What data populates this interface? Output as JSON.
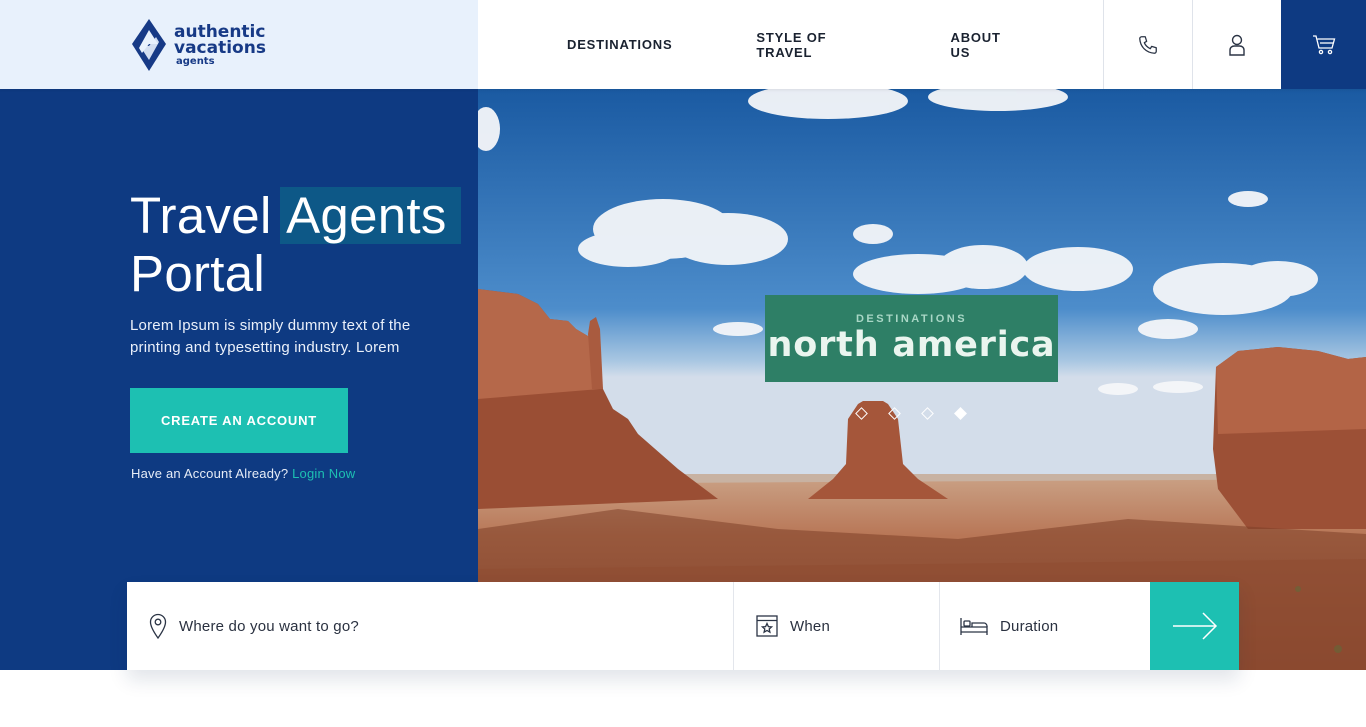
{
  "brand": {
    "line1": "authentic",
    "line2": "vacations",
    "line3": "agents"
  },
  "nav": {
    "items": [
      "DESTINATIONS",
      "STYLE OF TRAVEL",
      "ABOUT US"
    ]
  },
  "header_icons": [
    "phone-icon",
    "user-icon",
    "cart-icon"
  ],
  "hero": {
    "title_part1": "Travel",
    "title_highlight": "Agents",
    "title_part2": "Portal",
    "subtitle": "Lorem Ipsum is simply dummy text of the printing and typesetting industry. Lorem",
    "cta_label": "CREATE AN ACCOUNT",
    "login_prompt": "Have an Account Already?",
    "login_link": "Login Now"
  },
  "slide": {
    "kicker": "DESTINATIONS",
    "name": "north america",
    "dot_count": 4,
    "active_index": 3
  },
  "search": {
    "where_label": "Where do you want to go?",
    "when_label": "When",
    "duration_label": "Duration"
  },
  "colors": {
    "primary": "#0e3a82",
    "accent": "#1dc0b2",
    "card": "#2e7f66"
  }
}
